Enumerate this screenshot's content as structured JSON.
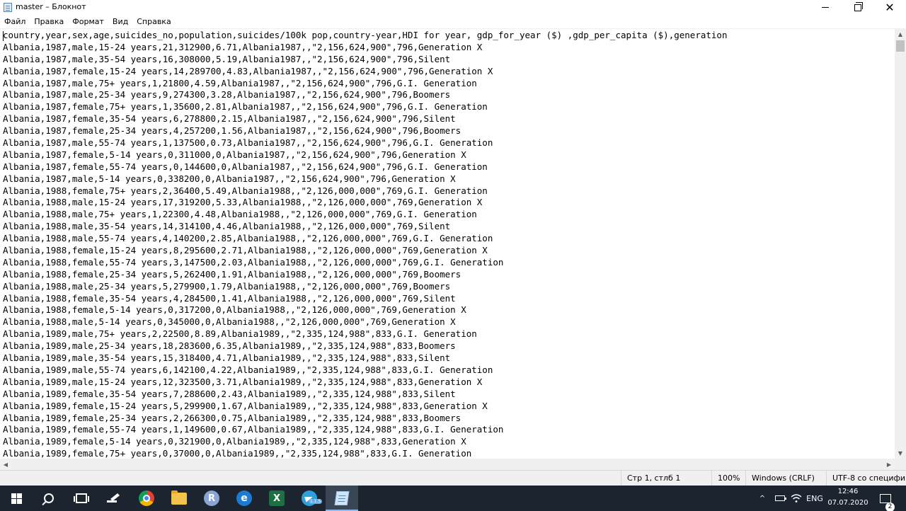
{
  "window": {
    "title": "master – Блокнот",
    "minimize_glyph": "",
    "close_glyph": "✕"
  },
  "menu": [
    "Файл",
    "Правка",
    "Формат",
    "Вид",
    "Справка"
  ],
  "editor": {
    "lines": [
      "country,year,sex,age,suicides_no,population,suicides/100k pop,country-year,HDI for year, gdp_for_year ($) ,gdp_per_capita ($),generation",
      "Albania,1987,male,15-24 years,21,312900,6.71,Albania1987,,\"2,156,624,900\",796,Generation X",
      "Albania,1987,male,35-54 years,16,308000,5.19,Albania1987,,\"2,156,624,900\",796,Silent",
      "Albania,1987,female,15-24 years,14,289700,4.83,Albania1987,,\"2,156,624,900\",796,Generation X",
      "Albania,1987,male,75+ years,1,21800,4.59,Albania1987,,\"2,156,624,900\",796,G.I. Generation",
      "Albania,1987,male,25-34 years,9,274300,3.28,Albania1987,,\"2,156,624,900\",796,Boomers",
      "Albania,1987,female,75+ years,1,35600,2.81,Albania1987,,\"2,156,624,900\",796,G.I. Generation",
      "Albania,1987,female,35-54 years,6,278800,2.15,Albania1987,,\"2,156,624,900\",796,Silent",
      "Albania,1987,female,25-34 years,4,257200,1.56,Albania1987,,\"2,156,624,900\",796,Boomers",
      "Albania,1987,male,55-74 years,1,137500,0.73,Albania1987,,\"2,156,624,900\",796,G.I. Generation",
      "Albania,1987,female,5-14 years,0,311000,0,Albania1987,,\"2,156,624,900\",796,Generation X",
      "Albania,1987,female,55-74 years,0,144600,0,Albania1987,,\"2,156,624,900\",796,G.I. Generation",
      "Albania,1987,male,5-14 years,0,338200,0,Albania1987,,\"2,156,624,900\",796,Generation X",
      "Albania,1988,female,75+ years,2,36400,5.49,Albania1988,,\"2,126,000,000\",769,G.I. Generation",
      "Albania,1988,male,15-24 years,17,319200,5.33,Albania1988,,\"2,126,000,000\",769,Generation X",
      "Albania,1988,male,75+ years,1,22300,4.48,Albania1988,,\"2,126,000,000\",769,G.I. Generation",
      "Albania,1988,male,35-54 years,14,314100,4.46,Albania1988,,\"2,126,000,000\",769,Silent",
      "Albania,1988,male,55-74 years,4,140200,2.85,Albania1988,,\"2,126,000,000\",769,G.I. Generation",
      "Albania,1988,female,15-24 years,8,295600,2.71,Albania1988,,\"2,126,000,000\",769,Generation X",
      "Albania,1988,female,55-74 years,3,147500,2.03,Albania1988,,\"2,126,000,000\",769,G.I. Generation",
      "Albania,1988,female,25-34 years,5,262400,1.91,Albania1988,,\"2,126,000,000\",769,Boomers",
      "Albania,1988,male,25-34 years,5,279900,1.79,Albania1988,,\"2,126,000,000\",769,Boomers",
      "Albania,1988,female,35-54 years,4,284500,1.41,Albania1988,,\"2,126,000,000\",769,Silent",
      "Albania,1988,female,5-14 years,0,317200,0,Albania1988,,\"2,126,000,000\",769,Generation X",
      "Albania,1988,male,5-14 years,0,345000,0,Albania1988,,\"2,126,000,000\",769,Generation X",
      "Albania,1989,male,75+ years,2,22500,8.89,Albania1989,,\"2,335,124,988\",833,G.I. Generation",
      "Albania,1989,male,25-34 years,18,283600,6.35,Albania1989,,\"2,335,124,988\",833,Boomers",
      "Albania,1989,male,35-54 years,15,318400,4.71,Albania1989,,\"2,335,124,988\",833,Silent",
      "Albania,1989,male,55-74 years,6,142100,4.22,Albania1989,,\"2,335,124,988\",833,G.I. Generation",
      "Albania,1989,male,15-24 years,12,323500,3.71,Albania1989,,\"2,335,124,988\",833,Generation X",
      "Albania,1989,female,35-54 years,7,288600,2.43,Albania1989,,\"2,335,124,988\",833,Silent",
      "Albania,1989,female,15-24 years,5,299900,1.67,Albania1989,,\"2,335,124,988\",833,Generation X",
      "Albania,1989,female,25-34 years,2,266300,0.75,Albania1989,,\"2,335,124,988\",833,Boomers",
      "Albania,1989,female,55-74 years,1,149600,0.67,Albania1989,,\"2,335,124,988\",833,G.I. Generation",
      "Albania,1989,female,5-14 years,0,321900,0,Albania1989,,\"2,335,124,988\",833,Generation X",
      "Albania,1989,female,75+ years,0,37000,0,Albania1989,,\"2,335,124,988\",833,G.I. Generation"
    ]
  },
  "statusbar": {
    "position": "Стр 1, стлб 1",
    "zoom": "100%",
    "line_ending": "Windows (CRLF)",
    "encoding": "UTF-8 со спецификацией"
  },
  "taskbar": {
    "apps": [
      {
        "name": "start-button",
        "icon": "windows-logo-icon"
      },
      {
        "name": "search-button",
        "icon": "search-icon"
      },
      {
        "name": "task-view-button",
        "icon": "task-view-icon"
      },
      {
        "name": "taskbar-app-pen",
        "icon": "pen-icon"
      },
      {
        "name": "taskbar-app-chrome",
        "icon": "chrome-icon"
      },
      {
        "name": "taskbar-app-explorer",
        "icon": "folder-icon"
      },
      {
        "name": "taskbar-app-r",
        "icon": "r-icon",
        "letter": "R"
      },
      {
        "name": "taskbar-app-edge",
        "icon": "edge-icon",
        "letter": "e"
      },
      {
        "name": "taskbar-app-excel",
        "icon": "excel-icon",
        "letter": "X"
      },
      {
        "name": "taskbar-app-telegram",
        "icon": "telegram-icon"
      },
      {
        "name": "taskbar-app-notepad",
        "icon": "notepad-icon"
      }
    ],
    "telegram_badge": "1.1.5",
    "tray": {
      "chevron": "^",
      "language": "ENG",
      "time": "12:46",
      "date": "07.07.2020",
      "notifications_count": "2"
    }
  },
  "colors": {
    "taskbar_bg": "#1c2430",
    "status_bg": "#f0f0f0",
    "active_app_bg": "#3a4555"
  }
}
